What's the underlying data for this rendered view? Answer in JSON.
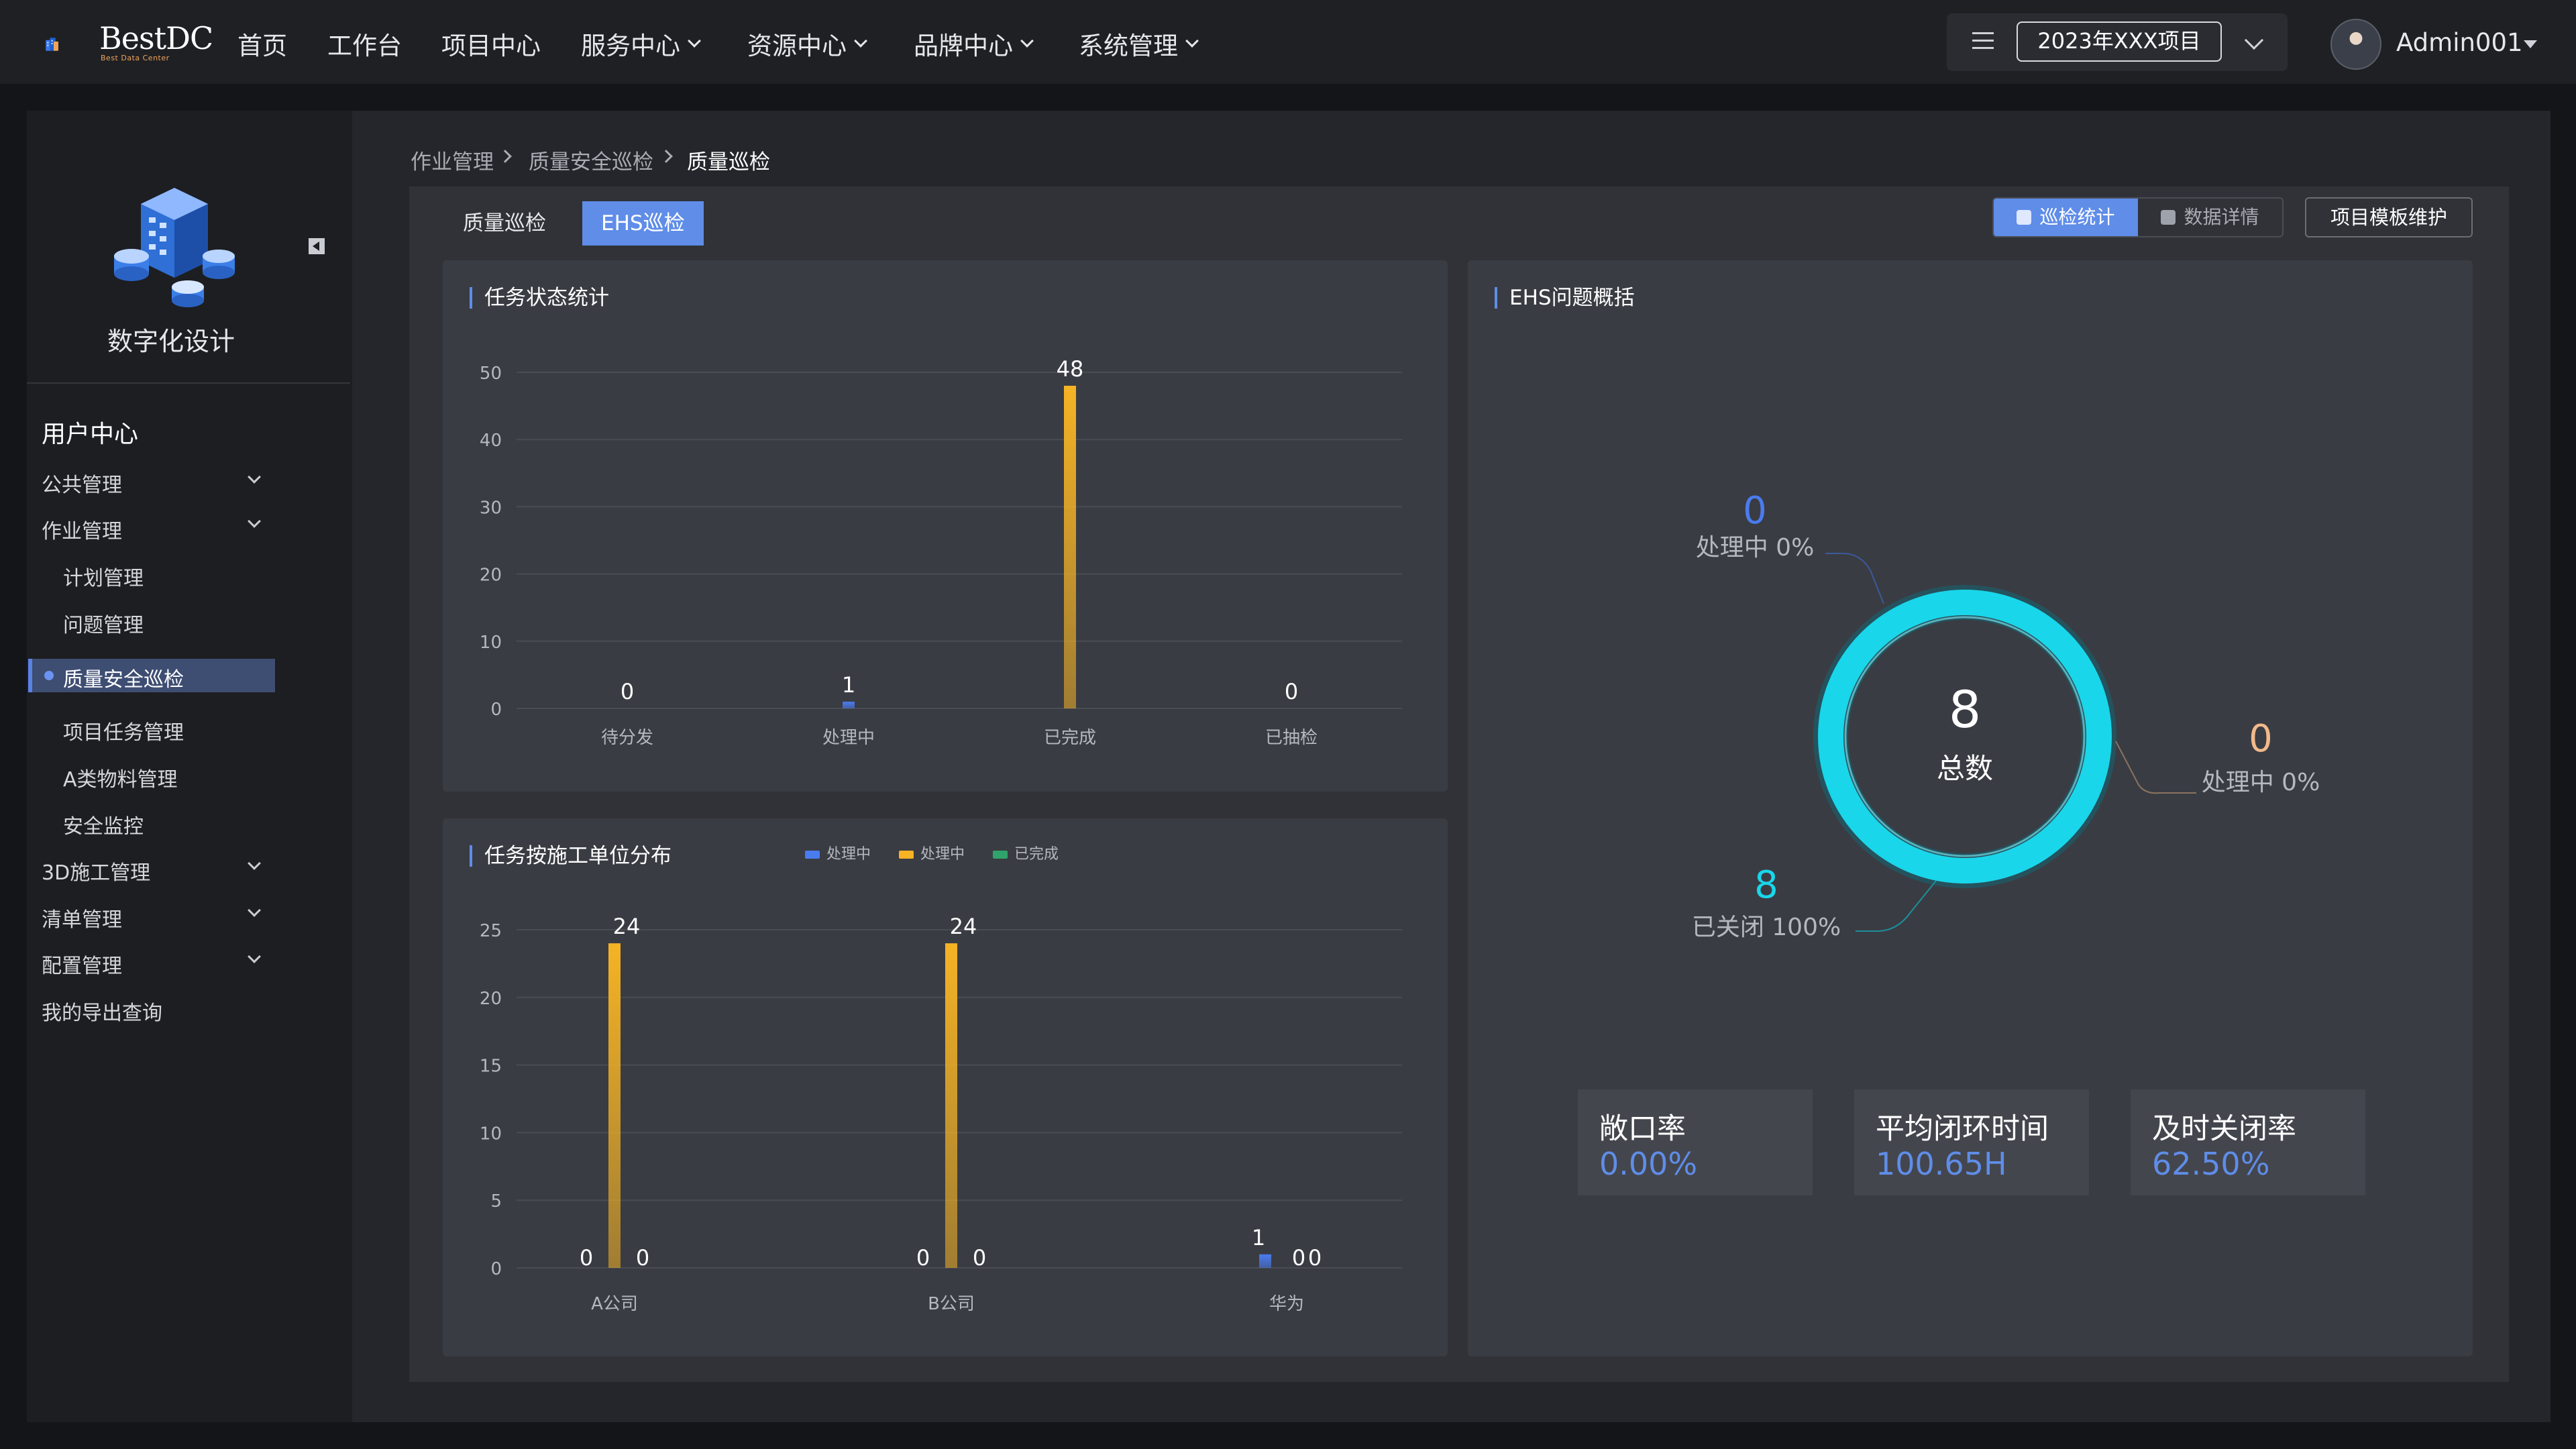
{
  "header": {
    "brand": "BestDC",
    "brand_sub": "Best Data Center",
    "nav": [
      {
        "label": "首页",
        "has_dropdown": false
      },
      {
        "label": "工作台",
        "has_dropdown": false
      },
      {
        "label": "项目中心",
        "has_dropdown": false
      },
      {
        "label": "服务中心",
        "has_dropdown": true
      },
      {
        "label": "资源中心",
        "has_dropdown": true
      },
      {
        "label": "品牌中心",
        "has_dropdown": true
      },
      {
        "label": "系统管理",
        "has_dropdown": true
      }
    ],
    "project_selector": "2023年XXX项目",
    "user_name": "Admin001"
  },
  "sidebar": {
    "title": "数字化设计",
    "section_title": "用户中心",
    "items": [
      {
        "label": "公共管理",
        "level": 1,
        "expandable": true
      },
      {
        "label": "作业管理",
        "level": 1,
        "expandable": true
      },
      {
        "label": "计划管理",
        "level": 2
      },
      {
        "label": "问题管理",
        "level": 2
      },
      {
        "label": "质量安全巡检",
        "level": 2,
        "active": true
      },
      {
        "label": "项目任务管理",
        "level": 2
      },
      {
        "label": "A类物料管理",
        "level": 2
      },
      {
        "label": "安全监控",
        "level": 2
      },
      {
        "label": "3D施工管理",
        "level": 1,
        "expandable": true
      },
      {
        "label": "清单管理",
        "level": 1,
        "expandable": true
      },
      {
        "label": "配置管理",
        "level": 1,
        "expandable": true
      },
      {
        "label": "我的导出查询",
        "level": 1
      }
    ]
  },
  "breadcrumb": [
    "作业管理",
    "质量安全巡检",
    "质量巡检"
  ],
  "tabs": [
    {
      "label": "质量巡检",
      "active": false
    },
    {
      "label": "EHS巡检",
      "active": true
    }
  ],
  "view_toggle": {
    "stats": "巡检统计",
    "details": "数据详情",
    "active": "stats"
  },
  "template_button": "项目模板维护",
  "panels": {
    "task_status_title": "任务状态统计",
    "task_unit_title": "任务按施工单位分布",
    "ehs_title": "EHS问题概括"
  },
  "chart_data": [
    {
      "type": "bar",
      "title": "任务状态统计",
      "categories": [
        "待分发",
        "处理中",
        "已完成",
        "已抽检"
      ],
      "values": [
        0,
        1,
        48,
        0
      ],
      "colors": [
        "#4a7cf0",
        "#4a7cf0",
        "#f5b325",
        "#f5b325"
      ],
      "ylim": [
        0,
        50
      ],
      "yticks": [
        0,
        10,
        20,
        30,
        40,
        50
      ],
      "grid": true,
      "data_labels": true
    },
    {
      "type": "bar",
      "title": "任务按施工单位分布",
      "categories": [
        "A公司",
        "B公司",
        "华为"
      ],
      "series": [
        {
          "name": "处理中",
          "values": [
            0,
            0,
            1
          ],
          "color": "#4a7cf0"
        },
        {
          "name": "处理中",
          "values": [
            24,
            24,
            0
          ],
          "color": "#f5b325"
        },
        {
          "name": "已完成",
          "values": [
            0,
            0,
            0
          ],
          "color": "#2fa36b"
        }
      ],
      "ylim": [
        0,
        25
      ],
      "yticks": [
        0,
        5,
        10,
        15,
        20,
        25
      ],
      "legend": "top-center",
      "grid": true,
      "data_labels": true
    },
    {
      "type": "pie",
      "title": "EHS问题概括",
      "center_value": 8,
      "center_label": "总数",
      "slices": [
        {
          "label": "处理中",
          "value": 0,
          "percent": "0%",
          "color": "#4a7cf0"
        },
        {
          "label": "处理中",
          "value": 0,
          "percent": "0%",
          "color": "#f2b98a"
        },
        {
          "label": "已关闭",
          "value": 8,
          "percent": "100%",
          "color": "#19d6ea"
        }
      ]
    }
  ],
  "ehs_stats": [
    {
      "label": "敞口率",
      "value": "0.00%"
    },
    {
      "label": "平均闭环时间",
      "value": "100.65H"
    },
    {
      "label": "及时关闭率",
      "value": "62.50%"
    }
  ],
  "colors": {
    "accent": "#5f8de8",
    "processing": "#4a7cf0",
    "completed_bar": "#f5b325",
    "closed_ring": "#19d6ea",
    "legend_green": "#2fa36b"
  }
}
